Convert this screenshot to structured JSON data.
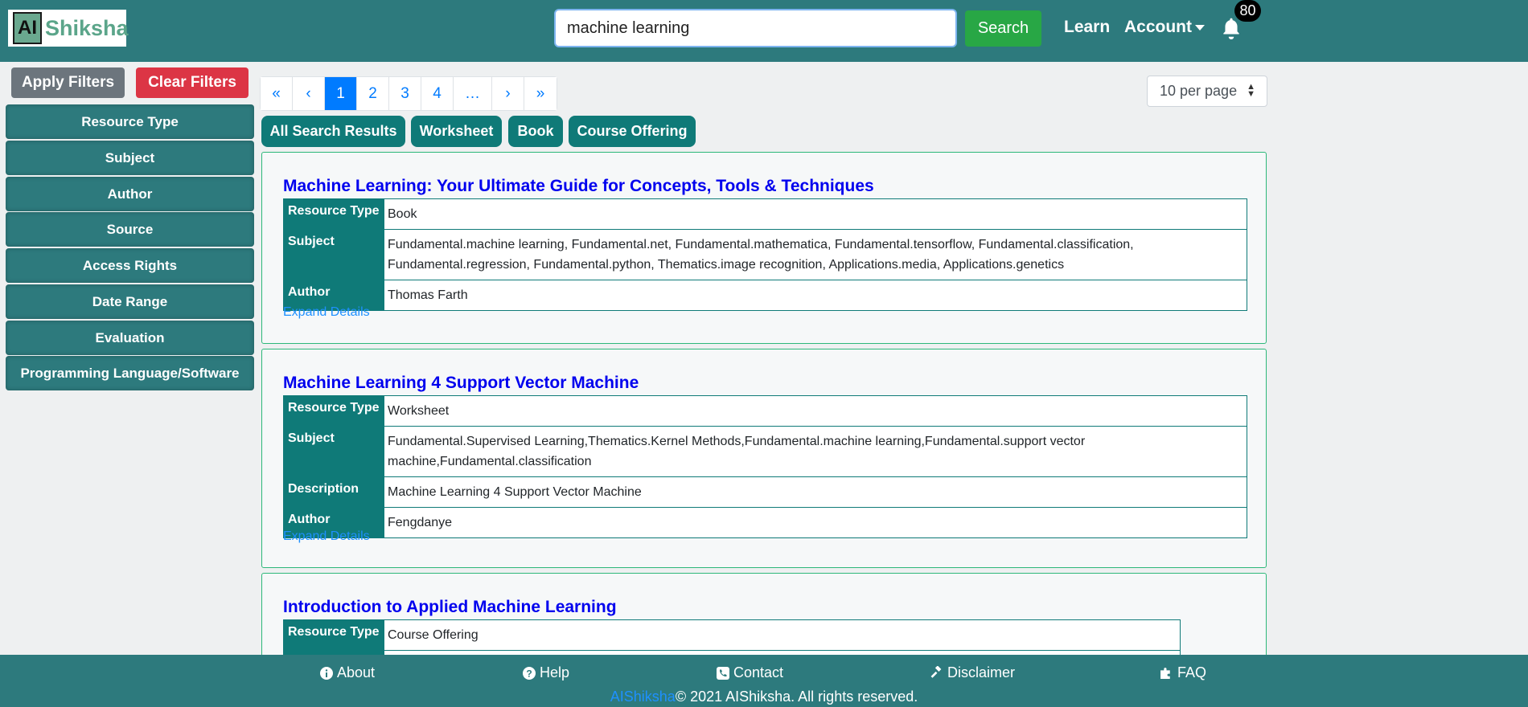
{
  "header": {
    "logo_ai": "AI",
    "logo_text": "Shiksha",
    "search_value": "machine learning",
    "search_button": "Search",
    "nav_learn": "Learn",
    "nav_account": "Account",
    "notification_count": "80"
  },
  "sidebar": {
    "apply_label": "Apply Filters",
    "clear_label": "Clear Filters",
    "filters": [
      "Resource Type",
      "Subject",
      "Author",
      "Source",
      "Access Rights",
      "Date Range",
      "Evaluation",
      "Programming Language/Software"
    ]
  },
  "pagination": {
    "first": "«",
    "prev": "‹",
    "pages": [
      "1",
      "2",
      "3",
      "4"
    ],
    "ellipsis": "…",
    "next": "›",
    "last": "»",
    "active_page": "1",
    "per_page": "10 per page"
  },
  "tabs": [
    "All Search Results",
    "Worksheet",
    "Book",
    "Course Offering"
  ],
  "results": [
    {
      "title": "Machine Learning: Your Ultimate Guide for Concepts, Tools & Techniques",
      "rows": [
        {
          "key": "Resource Type",
          "value": "Book"
        },
        {
          "key": "Subject",
          "value": "Fundamental.machine learning, Fundamental.net, Fundamental.mathematica, Fundamental.tensorflow, Fundamental.classification, Fundamental.regression, Fundamental.python, Thematics.image recognition, Applications.media, Applications.genetics"
        },
        {
          "key": "Author",
          "value": "Thomas Farth"
        }
      ],
      "expand": "Expand Details"
    },
    {
      "title": "Machine Learning 4 Support Vector Machine",
      "rows": [
        {
          "key": "Resource Type",
          "value": "Worksheet"
        },
        {
          "key": "Subject",
          "value": "Fundamental.Supervised Learning,Thematics.Kernel Methods,Fundamental.machine learning,Fundamental.support vector machine,Fundamental.classification"
        },
        {
          "key": "Description",
          "value": "Machine Learning 4 Support Vector Machine"
        },
        {
          "key": "Author",
          "value": "Fengdanye"
        }
      ],
      "expand": "Expand Details"
    },
    {
      "title": "Introduction to Applied Machine Learning",
      "rows": [
        {
          "key": "Resource Type",
          "value": "Course Offering"
        }
      ]
    }
  ],
  "footer": {
    "about": "About",
    "help": "Help",
    "contact": "Contact",
    "disclaimer": "Disclaimer",
    "faq": "FAQ",
    "brand": "AIShiksha",
    "copyright": "© 2021 AIShiksha. All rights reserved."
  },
  "colors": {
    "primary_teal": "#2d7a7d",
    "tab_teal": "#0f7a78",
    "search_green": "#28a745",
    "clear_red": "#dc3545",
    "link_blue": "#0000ee"
  }
}
